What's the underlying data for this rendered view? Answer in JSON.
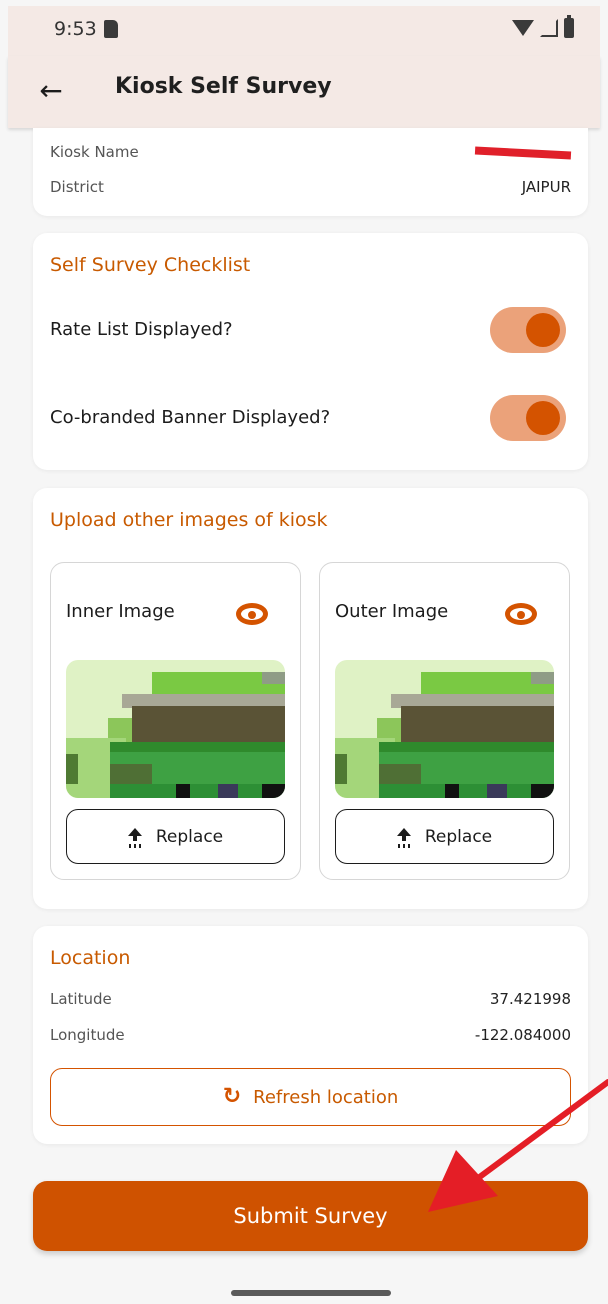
{
  "status_bar": {
    "time": "9:53"
  },
  "app_bar": {
    "title": "Kiosk Self Survey"
  },
  "kiosk_info": {
    "rows": [
      {
        "label": "Kiosk Name",
        "value": ""
      },
      {
        "label": "District",
        "value": "JAIPUR"
      }
    ]
  },
  "checklist": {
    "title": "Self Survey Checklist",
    "items": [
      {
        "label": "Rate List Displayed?",
        "checked": true
      },
      {
        "label": "Co-branded Banner Displayed?",
        "checked": true
      }
    ]
  },
  "images": {
    "title": "Upload other images of kiosk",
    "cards": [
      {
        "label": "Inner Image",
        "button": "Replace"
      },
      {
        "label": "Outer Image",
        "button": "Replace"
      }
    ]
  },
  "location": {
    "title": "Location",
    "rows": [
      {
        "label": "Latitude",
        "value": "37.421998"
      },
      {
        "label": "Longitude",
        "value": "-122.084000"
      }
    ],
    "refresh_label": "Refresh location"
  },
  "submit_label": "Submit Survey",
  "colors": {
    "accent": "#cf5200",
    "toggle_track": "#eba27a",
    "app_bar": "#f4e9e5"
  }
}
